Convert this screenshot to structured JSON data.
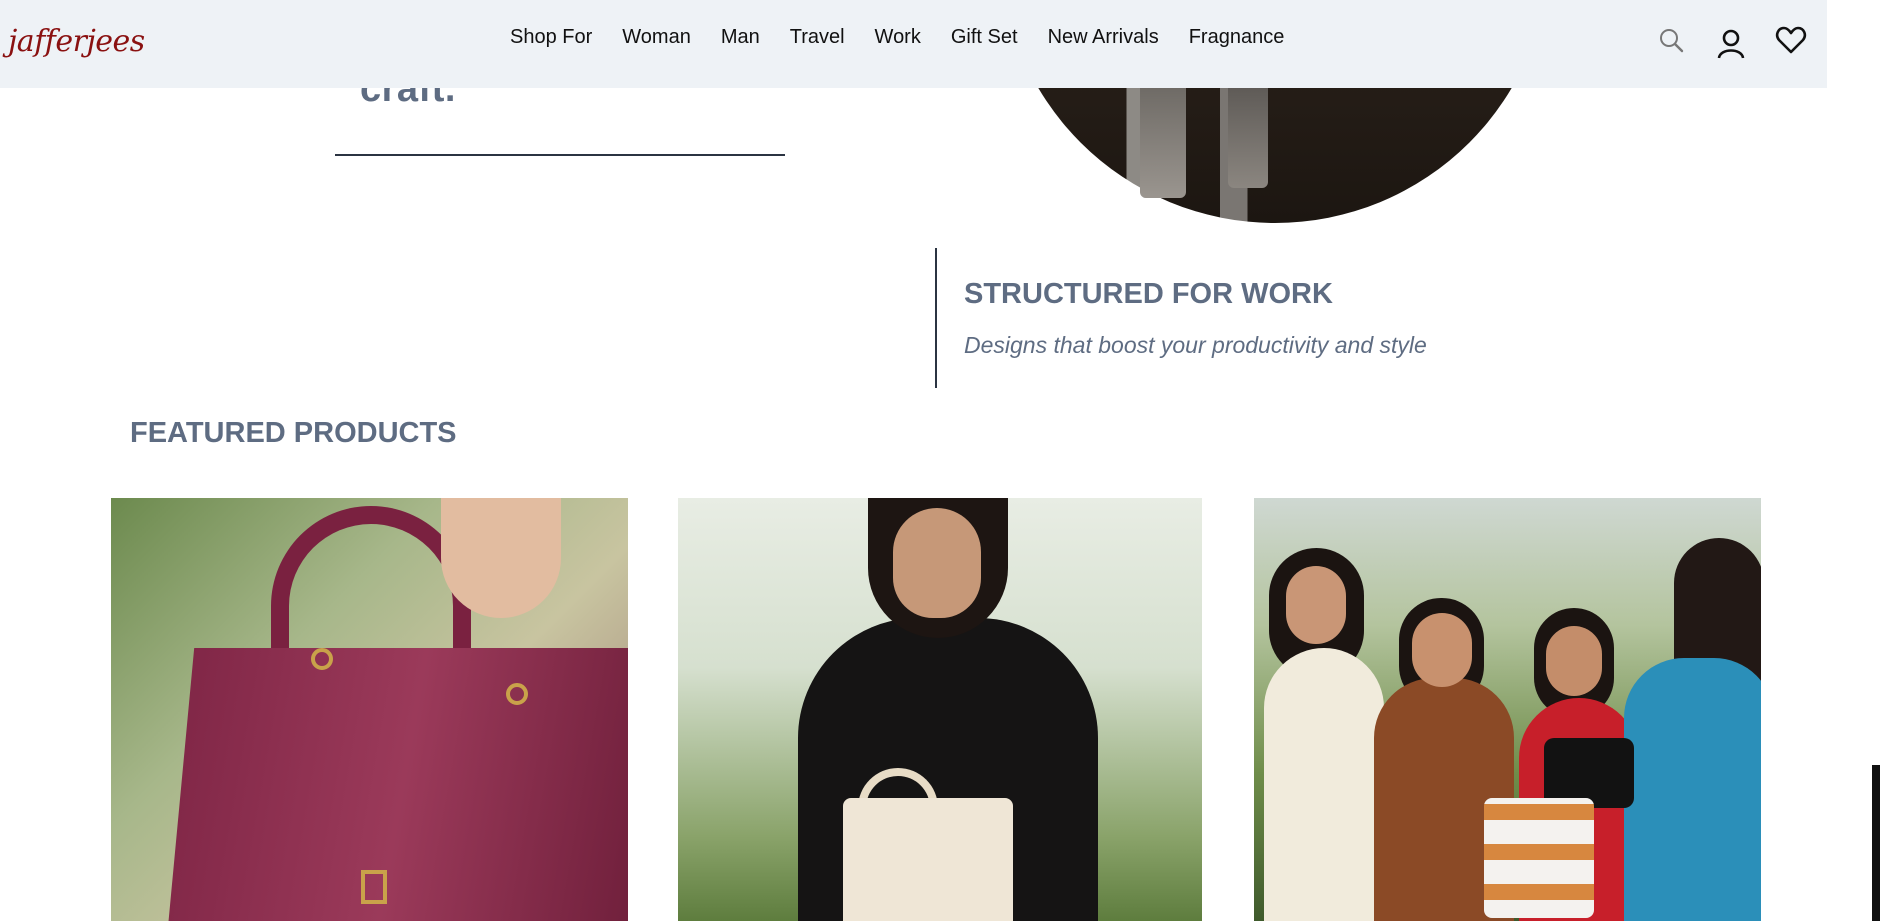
{
  "header": {
    "logo": "jafferjees",
    "nav": [
      "Shop For",
      "Woman",
      "Man",
      "Travel",
      "Work",
      "Gift Set",
      "New Arrivals",
      "Fragnance"
    ],
    "icons": [
      "search-icon",
      "user-icon",
      "heart-icon"
    ]
  },
  "hero": {
    "heading_fragment": "craft."
  },
  "work_section": {
    "title": "STRUCTURED FOR WORK",
    "subtitle": "Designs that boost your productivity and style"
  },
  "featured": {
    "title": "FEATURED PRODUCTS"
  },
  "colors": {
    "logo": "#8a1111",
    "heading": "#5e6c82",
    "header_bg": "#eef2f6"
  }
}
